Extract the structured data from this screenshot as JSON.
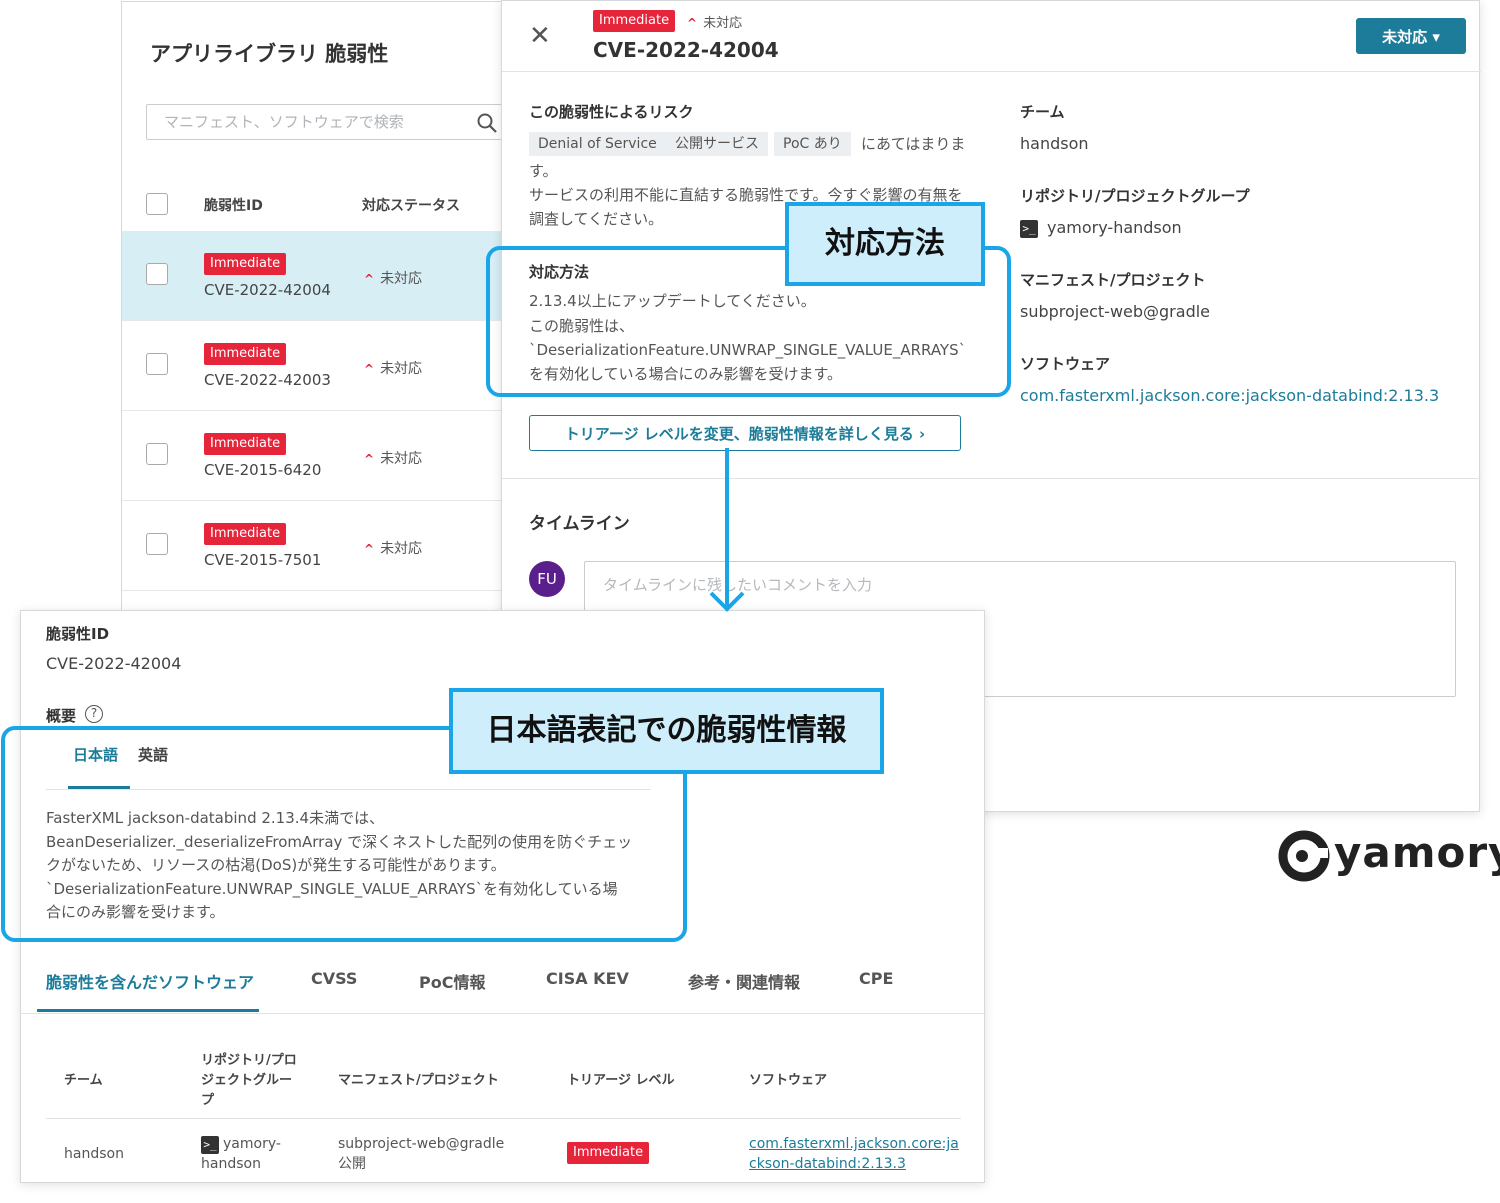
{
  "list_panel": {
    "title": "アプリライブラリ 脆弱性",
    "search_placeholder": "マニフェスト、ソフトウェアで検索",
    "columns": [
      "脆弱性ID",
      "対応ステータス"
    ],
    "rows": [
      {
        "badge": "Immediate",
        "cve": "CVE-2022-42004",
        "status": "未対応",
        "selected": true
      },
      {
        "badge": "Immediate",
        "cve": "CVE-2022-42003",
        "status": "未対応",
        "selected": false
      },
      {
        "badge": "Immediate",
        "cve": "CVE-2015-6420",
        "status": "未対応",
        "selected": false
      },
      {
        "badge": "Immediate",
        "cve": "CVE-2015-7501",
        "status": "未対応",
        "selected": false
      }
    ]
  },
  "detail": {
    "badge": "Immediate",
    "status": "未対応",
    "cve": "CVE-2022-42004",
    "status_button": "未対応 ▾",
    "risk_heading": "この脆弱性によるリスク",
    "risk_tags": [
      "Denial of Service",
      "公開サービス",
      "PoC あり"
    ],
    "risk_tail": "にあてはまりま",
    "risk_text_1": "す。",
    "risk_text_2": "サービスの利用不能に直結する脆弱性です。今すぐ影響の有無を",
    "risk_text_3": "調査してください。",
    "remedy_heading": "対応方法",
    "remedy_lines": [
      "2.13.4以上にアップデートしてください。",
      "この脆弱性は、",
      "`DeserializationFeature.UNWRAP_SINGLE_VALUE_ARRAYS`",
      "を有効化している場合にのみ影響を受けます。"
    ],
    "triage_button": "トリアージ レベルを変更、脆弱性情報を詳しく見る ›",
    "team_heading": "チーム",
    "team_value": "handson",
    "repo_heading": "リポジトリ/プロジェクトグループ",
    "repo_value": "yamory-handson",
    "manifest_heading": "マニフェスト/プロジェクト",
    "manifest_value": "subproject-web@gradle",
    "software_heading": "ソフトウェア",
    "software_value": "com.fasterxml.jackson.core:jackson-databind:2.13.3",
    "timeline_heading": "タイムライン",
    "avatar": "FU",
    "comment_placeholder": "タイムラインに残したいコメントを入力"
  },
  "vuln_panel": {
    "id_label": "脆弱性ID",
    "id_value": "CVE-2022-42004",
    "overview_label": "概要",
    "help_icon": "?",
    "lang_tabs": [
      "日本語",
      "英語"
    ],
    "overview_lines": [
      "FasterXML jackson-databind 2.13.4未満では、",
      "BeanDeserializer._deserializeFromArray で深くネストした配列の使用を防ぐチェッ",
      "クがないため、リソースの枯渇(DoS)が発生する可能性があります。",
      "`DeserializationFeature.UNWRAP_SINGLE_VALUE_ARRAYS`を有効化している場",
      "合にのみ影響を受けます。"
    ],
    "tabs": [
      "脆弱性を含んだソフトウェア",
      "CVSS",
      "PoC情報",
      "CISA KEV",
      "参考・関連情報",
      "CPE"
    ],
    "table_headers": {
      "team": "チーム",
      "repo_1": "リポジトリ/プロ",
      "repo_2": "ジェクトグルー",
      "repo_3": "プ",
      "manifest": "マニフェスト/プロジェクト",
      "triage": "トリアージ レベル",
      "software": "ソフトウェア"
    },
    "table_row": {
      "team": "handson",
      "repo_1": "yamory-",
      "repo_2": "handson",
      "manifest_1": "subproject-web@gradle",
      "manifest_2": "公開",
      "triage": "Immediate",
      "software_1": "com.fasterxml.jackson.core:ja",
      "software_2": "ckson-databind:2.13.3"
    }
  },
  "callouts": {
    "remedy": "対応方法",
    "japanese_info": "日本語表記での脆弱性情報"
  },
  "logo": {
    "text": "yamory"
  },
  "colors": {
    "accent": "#1c7c99",
    "badge_red": "#e6243a",
    "callout_blue": "#1aa5e8",
    "callout_fill": "#ceeefc",
    "selected_row": "#d6eef4",
    "avatar": "#5a1f8c"
  }
}
